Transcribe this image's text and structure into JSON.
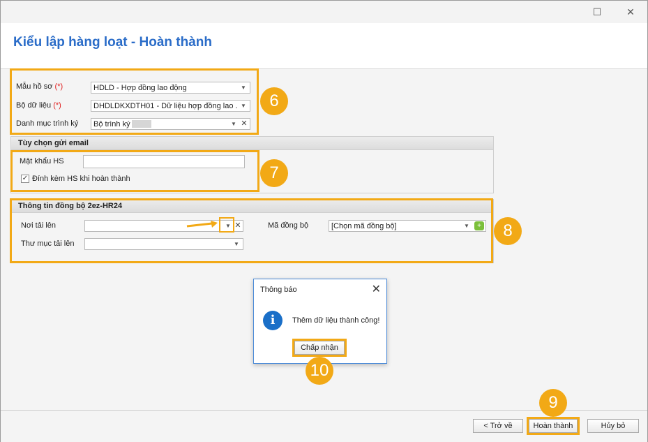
{
  "window": {
    "minimize_icon": "☐",
    "close_icon": "✕"
  },
  "page": {
    "title": "Kiểu lập hàng loạt - Hoàn thành"
  },
  "form": {
    "mau_ho_so": {
      "label": "Mẫu hồ sơ",
      "required": "(*)",
      "value": "HDLD - Hợp đồng lao động"
    },
    "bo_du_lieu": {
      "label": "Bộ dữ liệu",
      "required": "(*)",
      "value": "DHDLDKXDTH01 - Dữ liệu hợp đồng lao ..."
    },
    "danh_muc_trinh_ky": {
      "label": "Danh mục trình ký",
      "value": "Bộ trình ký"
    }
  },
  "email_options": {
    "header": "Tùy chọn gửi email",
    "password": {
      "label": "Mật khẩu HS",
      "value": ""
    },
    "attach": {
      "label": "Đính kèm HS khi hoàn thành",
      "checked": true
    }
  },
  "sync": {
    "header": "Thông tin đồng bộ 2ez-HR24",
    "noi_tai_len": {
      "label": "Nơi tải lên",
      "value": ""
    },
    "thu_muc_tai_len": {
      "label": "Thư mục tải lên",
      "value": ""
    },
    "ma_dong_bo": {
      "label": "Mã đồng bộ",
      "value": "[Chọn mã đồng bộ]"
    }
  },
  "badges": {
    "b6": "6",
    "b7": "7",
    "b8": "8",
    "b9": "9",
    "b10": "10"
  },
  "dialog": {
    "title": "Thông báo",
    "close_icon": "✕",
    "icon": "i",
    "message": "Thêm dữ liệu thành công!",
    "ok_label": "Chấp nhận"
  },
  "footer": {
    "back_label": "< Trở về",
    "finish_label": "Hoàn thành",
    "cancel_label": "Hủy bỏ"
  },
  "colors": {
    "accent": "#f2a916",
    "title": "#2a6cc8",
    "info": "#1a6fc8"
  }
}
